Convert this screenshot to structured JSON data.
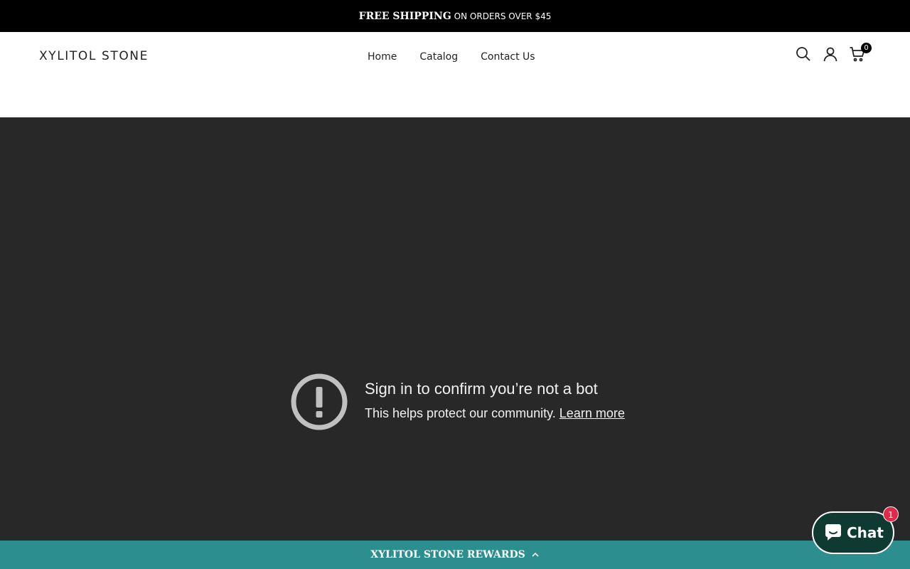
{
  "announcement": {
    "strong_text": "FREE SHIPPING",
    "rest_text": "ON ORDERS OVER $45"
  },
  "header": {
    "logo": "XYLITOL STONE",
    "nav": [
      {
        "label": "Home"
      },
      {
        "label": "Catalog"
      },
      {
        "label": "Contact Us"
      }
    ],
    "icons": [
      "search-icon",
      "account-icon",
      "cart-icon"
    ],
    "cart_count": "0"
  },
  "video": {
    "title": "Sign in to confirm you’re not a bot",
    "subtitle": "This helps protect our community.",
    "learn_more": "Learn more",
    "icon": "alert-icon"
  },
  "rewards": {
    "label": "XYLITOL STONE REWARDS",
    "icon": "chevron-up-icon"
  },
  "chat": {
    "label": "Chat",
    "badge": "1",
    "icon": "chat-bubble-icon"
  },
  "colors": {
    "announcement_bg": "#000000",
    "video_bg": "#282828",
    "rewards_bg": "#2c8e8e",
    "chat_bg": "#0f3a31",
    "badge_red": "#e02a4a"
  }
}
